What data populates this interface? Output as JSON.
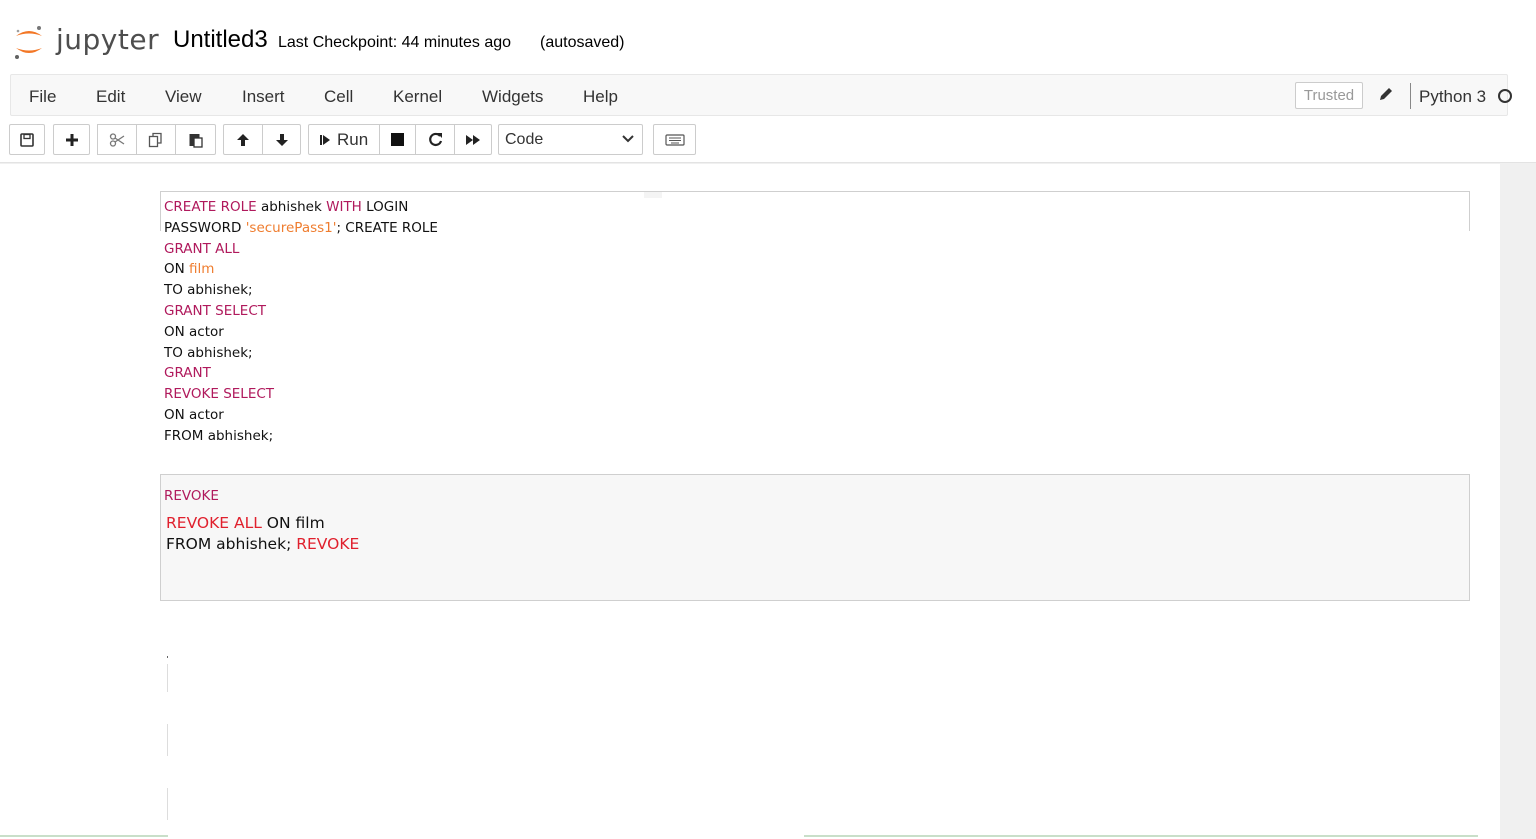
{
  "header": {
    "logo_text": "jupyter",
    "notebook_name": "Untitled3",
    "checkpoint": "Last Checkpoint: 44 minutes ago",
    "autosave": "(autosaved)"
  },
  "menubar": {
    "items": [
      "File",
      "Edit",
      "View",
      "Insert",
      "Cell",
      "Kernel",
      "Widgets",
      "Help"
    ],
    "trusted": "Trusted",
    "kernel_name": "Python 3"
  },
  "toolbar": {
    "run_label": "Run",
    "cell_type": "Code",
    "buttons": [
      "save-icon",
      "plus-icon",
      "cut-icon",
      "copy-icon",
      "paste-icon",
      "arrow-up-icon",
      "arrow-down-icon",
      "run-icon",
      "stop-icon",
      "restart-icon",
      "fast-forward-icon",
      "keyboard-icon"
    ]
  },
  "cells": {
    "cell1": {
      "lines": [
        [
          {
            "t": "CREATE ROLE",
            "c": "kw"
          },
          {
            "t": " abhishek ",
            "c": "txt"
          },
          {
            "t": "WITH",
            "c": "kw"
          },
          {
            "t": " LOGIN",
            "c": "txt"
          }
        ],
        [
          {
            "t": "PASSWORD ",
            "c": "txt"
          },
          {
            "t": "'securePass1'",
            "c": "str"
          },
          {
            "t": "; CREATE ROLE",
            "c": "txt"
          }
        ],
        [
          {
            "t": "GRANT ALL",
            "c": "kw"
          }
        ],
        [
          {
            "t": "ON ",
            "c": "txt"
          },
          {
            "t": "film",
            "c": "str"
          }
        ],
        [
          {
            "t": "TO abhishek;",
            "c": "txt"
          }
        ],
        [
          {
            "t": "GRANT SELECT",
            "c": "kw"
          }
        ],
        [
          {
            "t": "ON actor",
            "c": "txt"
          }
        ],
        [
          {
            "t": "TO abhishek;",
            "c": "txt"
          }
        ],
        [
          {
            "t": "GRANT",
            "c": "kw"
          }
        ],
        [
          {
            "t": "REVOKE SELECT",
            "c": "kw"
          }
        ],
        [
          {
            "t": "ON actor",
            "c": "txt"
          }
        ],
        [
          {
            "t": "FROM abhishek;",
            "c": "txt"
          }
        ]
      ]
    },
    "cell2": {
      "heading": "REVOKE",
      "lines": [
        [
          {
            "t": "REVOKE ALL",
            "c": "red"
          },
          {
            "t": " ON film",
            "c": "txt"
          }
        ],
        [
          {
            "t": "FROM abhishek; ",
            "c": "txt"
          },
          {
            "t": "REVOKE",
            "c": "red"
          }
        ]
      ]
    }
  },
  "colors": {
    "keyword": "#b0195c",
    "string": "#ef7d2f",
    "red_keyword": "#e0202d",
    "cell_bg": "#f7f7f7"
  }
}
